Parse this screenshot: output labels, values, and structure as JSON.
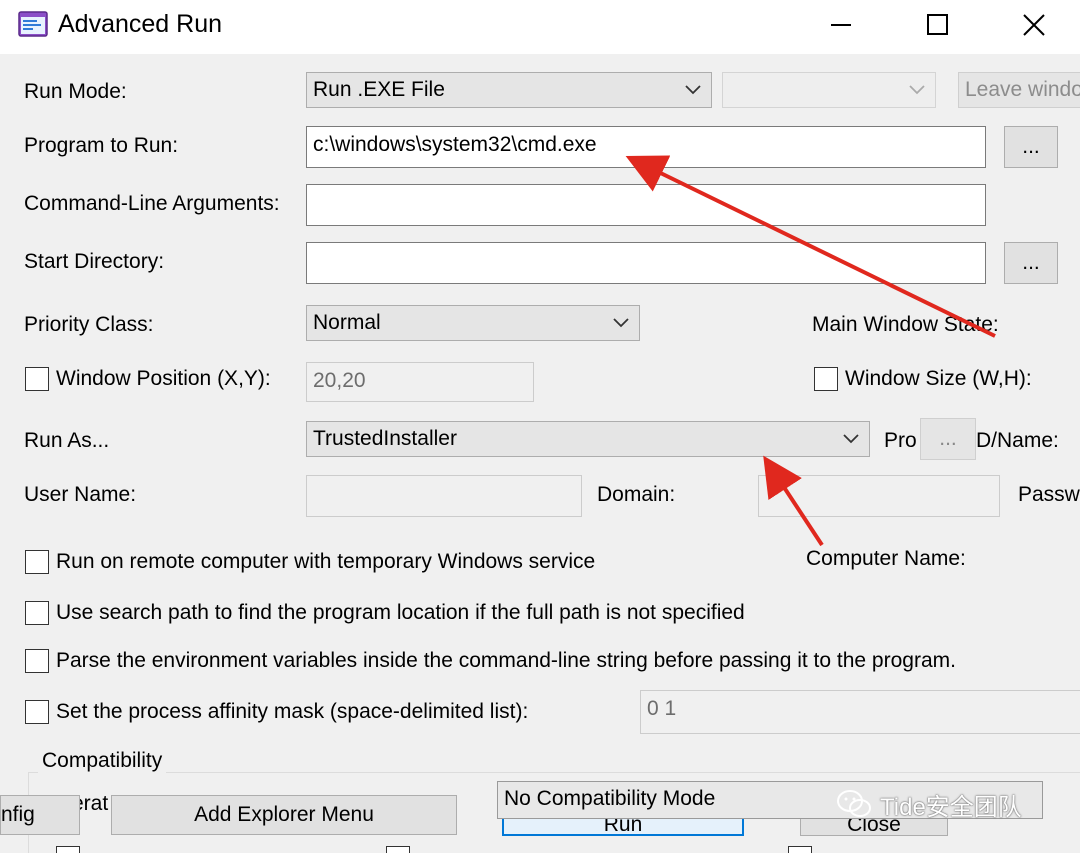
{
  "window": {
    "title": "Advanced Run"
  },
  "form": {
    "run_mode_label": "Run Mode:",
    "run_mode_value": "Run .EXE File",
    "run_mode_extra_value": "",
    "leave_window_button": "Leave windo",
    "program_label": "Program to Run:",
    "program_value": "c:\\windows\\system32\\cmd.exe",
    "browse_button": "...",
    "args_label": "Command-Line Arguments:",
    "args_value": "",
    "start_dir_label": "Start Directory:",
    "start_dir_value": "",
    "priority_label": "Priority Class:",
    "priority_value": "Normal",
    "main_window_state_label": "Main Window State:",
    "window_position_label": "Window Position (X,Y):",
    "window_position_value": "20,20",
    "window_size_label": "Window Size (W,H):",
    "run_as_label": "Run As...",
    "run_as_value": "TrustedInstaller",
    "process_id_label_start": "Pro",
    "process_id_label_end": "D/Name:",
    "process_picker_button": "...",
    "user_name_label": "User Name:",
    "user_name_value": "",
    "domain_label": "Domain:",
    "domain_value": "",
    "password_label": "Passw",
    "computer_name_label": "Computer Name:",
    "remote_checkbox_label": "Run on remote computer with temporary Windows service",
    "search_path_checkbox_label": "Use search path to find the program location if the full path is not specified",
    "parse_env_checkbox_label": "Parse the environment variables inside the command-line string before passing it to the program.",
    "affinity_checkbox_label": "Set the process affinity mask (space-delimited list):",
    "affinity_value": "0 1"
  },
  "compatibility": {
    "group_title": "Compatibility",
    "partial_label": "erat",
    "mode_value": "No Compatibility Mode"
  },
  "bottom_buttons": {
    "config": "nfig",
    "add_explorer_menu": "Add Explorer Menu",
    "run": "Run",
    "close": "Close"
  },
  "watermark": {
    "text": "Tide安全团队"
  },
  "annotation": {
    "arrow_color": "#e0281e"
  }
}
